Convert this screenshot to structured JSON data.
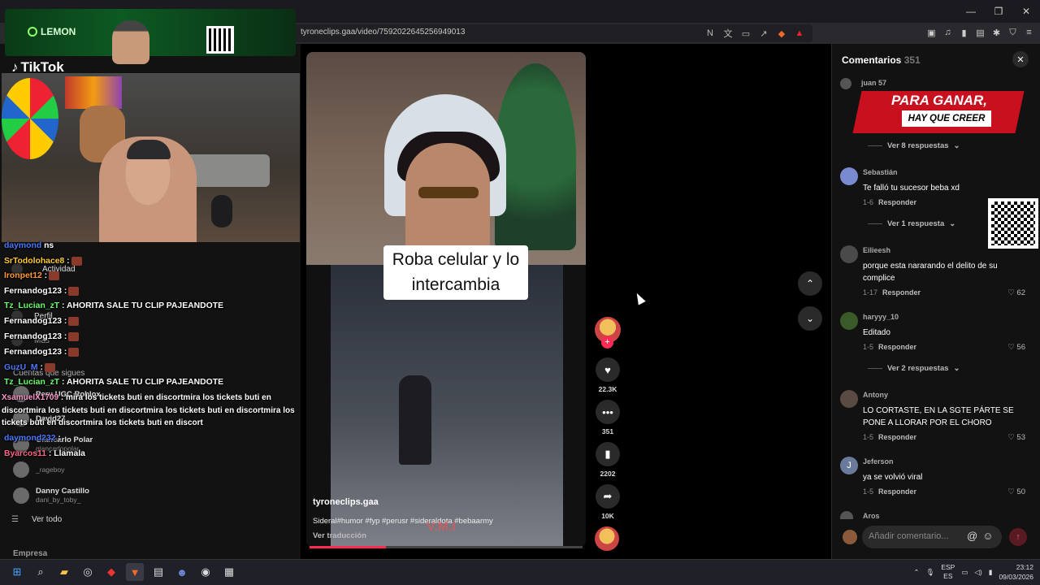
{
  "browser": {
    "url": "tyroneclips.gaa/video/7592022645256949013"
  },
  "overlay": {
    "sponsor": "LEMON",
    "platform": "TikTok"
  },
  "sidebar": {
    "items": [
      "Actividad",
      "Perfil",
      "Más"
    ],
    "following_title": "Cuentas que sigues",
    "following": [
      {
        "name": "Peru UGC Roblox",
        "handle": ""
      },
      {
        "name": "David27",
        "handle": ""
      },
      {
        "name": "Giancarlo Polar",
        "handle": "giancarlopolar"
      },
      {
        "name": "",
        "handle": "_rageboy"
      },
      {
        "name": "Danny Castillo",
        "handle": "dani_by_toby_"
      }
    ],
    "see_all": "Ver todo",
    "company": "Empresa"
  },
  "chat": {
    "lines": [
      {
        "user": "daymond",
        "msg": "ns",
        "color": "#4a7aff"
      },
      {
        "user": "SrTodolohace8",
        "msg": ":",
        "color": "#ffcc33"
      },
      {
        "user": "Ironpet12",
        "msg": ":",
        "color": "#ff9933"
      },
      {
        "user": "Fernandog123",
        "msg": ":",
        "color": "#ffffff"
      },
      {
        "user": "Tz_Lucian_zT",
        "msg": ": AHORITA SALE TU CLIP PAJEANDOTE",
        "color": "#66ff66"
      },
      {
        "user": "Fernandog123",
        "msg": ":",
        "color": "#ffffff"
      },
      {
        "user": "Fernandog123",
        "msg": ":",
        "color": "#ffffff"
      },
      {
        "user": "Fernandog123",
        "msg": ":",
        "color": "#ffffff"
      },
      {
        "user": "GuzU_M",
        "msg": ":",
        "color": "#4a7aff"
      },
      {
        "user": "Tz_Lucian_zT",
        "msg": ": AHORITA SALE TU CLIP PAJEANDOTE",
        "color": "#66ff66"
      }
    ],
    "long_user": "XsamuelX1709",
    "long_msg": ": mira los tickets buti en discortmira los tickets buti en discortmira los tickets buti en discortmira los tickets buti en discortmira los tickets buti en discortmira los tickets buti en discort",
    "after": [
      {
        "user": "daymond232",
        "msg": ":",
        "color": "#4a7aff"
      },
      {
        "user": "Byarcos11",
        "msg": ": Llamala",
        "color": "#ff6688"
      }
    ]
  },
  "video": {
    "caption_line1": "Roba celular y lo",
    "caption_line2": "intercambia",
    "author": "tyroneclips.gaa",
    "description": "Sideral#humor #fyp #perusr #sideraldota #bebaarmy",
    "translate": "Ver traducción",
    "watermark": "V.M.I",
    "progress": 0.28
  },
  "actions": {
    "likes": "22.3K",
    "comments": "351",
    "saves": "2202",
    "shares": "10K"
  },
  "comments": {
    "title": "Comentarios",
    "count": "351",
    "promo_line1": "PARA GANAR,",
    "promo_line2": "HAY QUE CREER",
    "items": [
      {
        "user": "juan 57",
        "text": "",
        "date": "",
        "reply": "",
        "likes": "",
        "more": "Ver 8 respuestas"
      },
      {
        "user": "Sebastián",
        "text": "Te falló tu sucesor beba xd",
        "date": "1-6",
        "reply": "Responder",
        "likes": "",
        "more": "Ver 1 respuesta"
      },
      {
        "user": "Eilieesh",
        "text": "porque esta nararando el delito de su complice",
        "date": "1-17",
        "reply": "Responder",
        "likes": "62",
        "more": ""
      },
      {
        "user": "haryyy_10",
        "text": "Editado",
        "date": "1-5",
        "reply": "Responder",
        "likes": "56",
        "more": "Ver 2 respuestas"
      },
      {
        "user": "Antony",
        "text": "LO CORTASTE, EN LA SGTE PÁRTE SE PONE A LLORAR POR EL CHORO",
        "date": "1-5",
        "reply": "Responder",
        "likes": "53",
        "more": ""
      },
      {
        "user": "Jeferson",
        "text": "ya se volvió viral",
        "date": "1-5",
        "reply": "Responder",
        "likes": "50",
        "more": ""
      },
      {
        "user": "Aros",
        "text": "",
        "date": "",
        "reply": "",
        "likes": "",
        "more": ""
      }
    ],
    "input_placeholder": "Añadir comentario..."
  },
  "taskbar": {
    "lang_top": "ESP",
    "lang_bottom": "ES",
    "time": "23:12",
    "date": "09/03/2026"
  }
}
